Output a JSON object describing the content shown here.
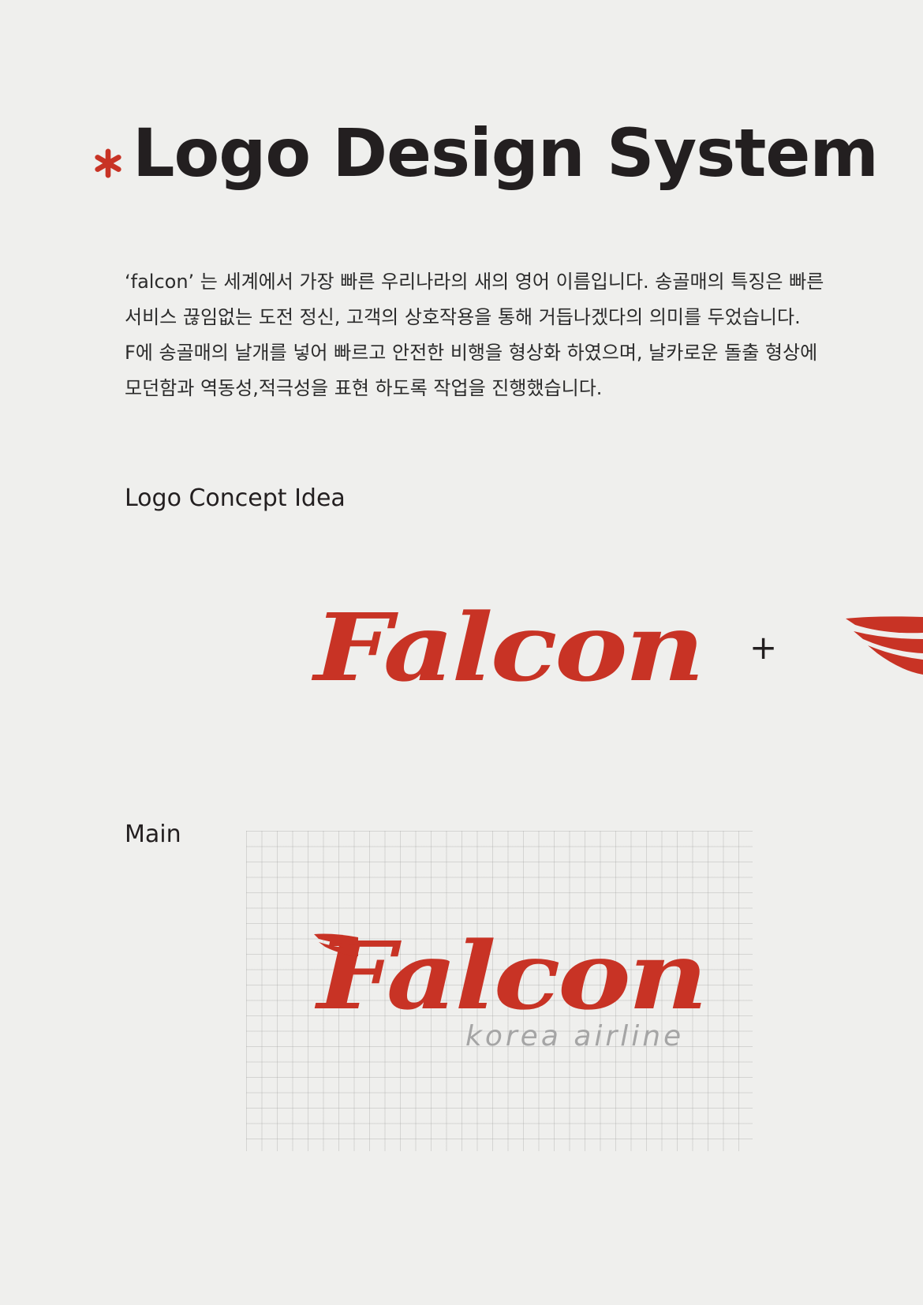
{
  "header": {
    "title": "Logo Design System"
  },
  "intro": {
    "lines": [
      "‘falcon’ 는 세계에서 가장 빠른 우리나라의 새의 영어 이름입니다. 송골매의 특징은 빠른",
      "서비스 끊임없는 도전 정신, 고객의 상호작용을 통해 거듭나겠다의 의미를 두었습니다.",
      "F에 송골매의 날개를 넣어 빠르고 안전한 비행을 형상화 하였으며, 날카로운 돌출 형상에",
      "모던함과 역동성,적극성을 표현 하도록 작업을 진행했습니다."
    ]
  },
  "concept": {
    "label": "Logo Concept Idea",
    "wordmark": "Falcon",
    "plus": "+"
  },
  "main": {
    "label": "Main",
    "wordmark": "Falcon",
    "subbrand": "korea airline"
  },
  "colors": {
    "brand_red": "#c83325",
    "text_dark": "#231f20",
    "sub_gray": "#a5a5a5",
    "background": "#efefed"
  },
  "icons": {
    "title_mark": "asterisk-icon",
    "wing": "falcon-wing-icon"
  }
}
